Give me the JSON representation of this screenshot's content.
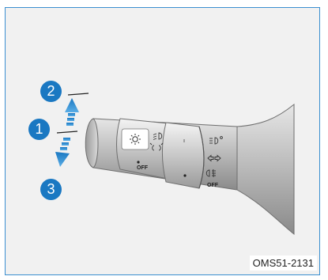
{
  "figure_code": "OMS51-2131",
  "steps": [
    {
      "number": "1"
    },
    {
      "number": "2"
    },
    {
      "number": "3"
    }
  ],
  "switch_labels": {
    "off_inner": "OFF",
    "off_outer": "OFF"
  },
  "icons": [
    "auto-light-icon",
    "headlamp-low-beam-icon",
    "parking-light-icon",
    "high-beam-icon",
    "turn-signal-arrows-icon",
    "fog-light-icon"
  ],
  "colors": {
    "accent": "#1a78c2",
    "frame_border": "#3a8fd0",
    "background": "#f1f1f1"
  }
}
